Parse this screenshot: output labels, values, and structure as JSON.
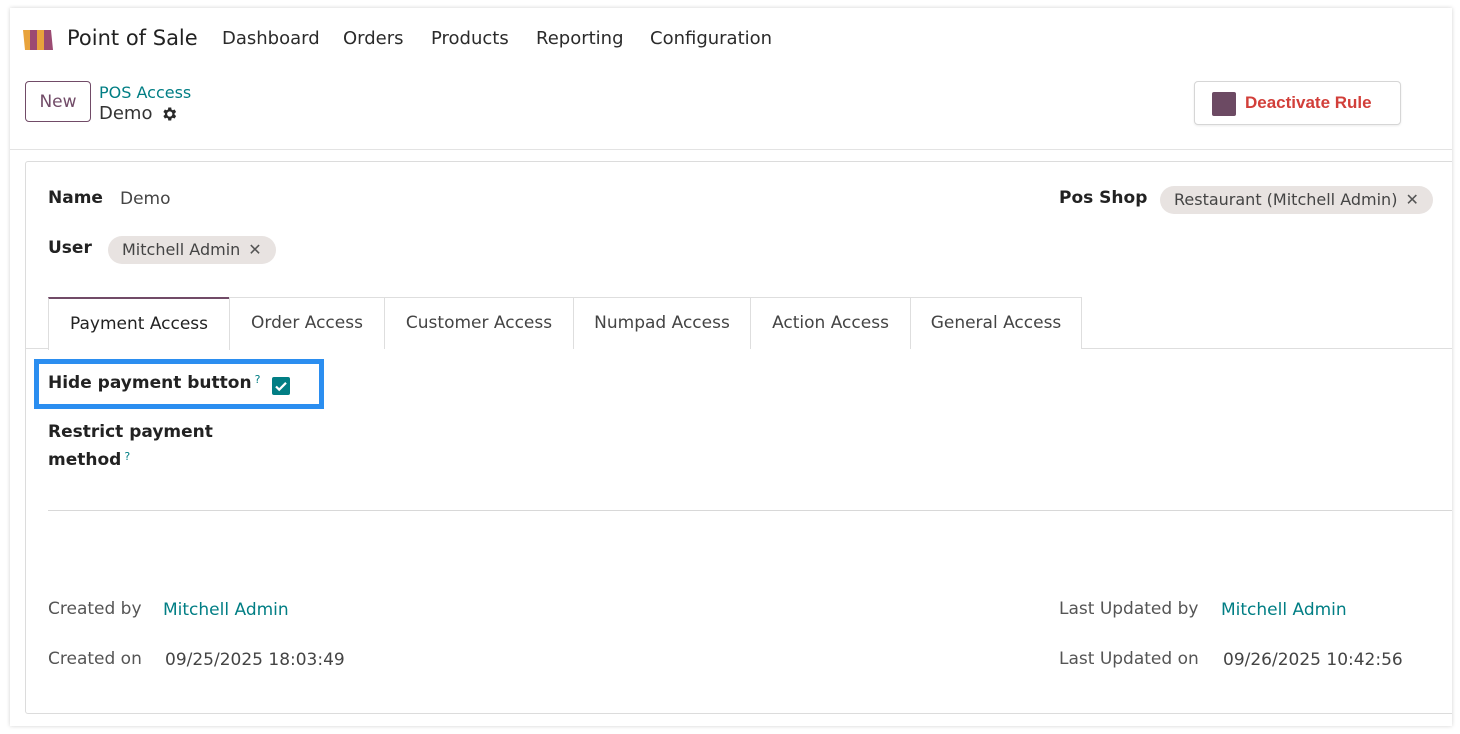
{
  "navbar": {
    "app_name": "Point of Sale",
    "menu": [
      "Dashboard",
      "Orders",
      "Products",
      "Reporting",
      "Configuration"
    ]
  },
  "control_panel": {
    "new_label": "New",
    "breadcrumb_parent": "POS Access",
    "record_name": "Demo",
    "deactivate_label": "Deactivate Rule"
  },
  "form": {
    "name_label": "Name",
    "name_value": "Demo",
    "user_label": "User",
    "user_tag": "Mitchell Admin",
    "pos_shop_label": "Pos Shop",
    "pos_shop_tag": "Restaurant (Mitchell Admin)",
    "tabs": [
      "Payment Access",
      "Order Access",
      "Customer Access",
      "Numpad Access",
      "Action Access",
      "General Access"
    ],
    "active_tab": "Payment Access",
    "hide_payment_label": "Hide payment button",
    "hide_payment_checked": true,
    "restrict_payment_label_line1": "Restrict payment",
    "restrict_payment_label_line2": "method",
    "help_marker": "?"
  },
  "meta": {
    "created_by_label": "Created by",
    "created_by_value": "Mitchell Admin",
    "created_on_label": "Created on",
    "created_on_value": "09/25/2025 18:03:49",
    "updated_by_label": "Last Updated by",
    "updated_by_value": "Mitchell Admin",
    "updated_on_label": "Last Updated on",
    "updated_on_value": "09/26/2025 10:42:56"
  },
  "colors": {
    "brand": "#714b67",
    "link": "#017e84",
    "danger": "#d23f3a",
    "highlight": "#2b8ef0"
  },
  "icons": {
    "app_logo": "pos-awning-icon",
    "gear": "gear-icon",
    "remove": "close-icon",
    "check": "check-icon"
  }
}
